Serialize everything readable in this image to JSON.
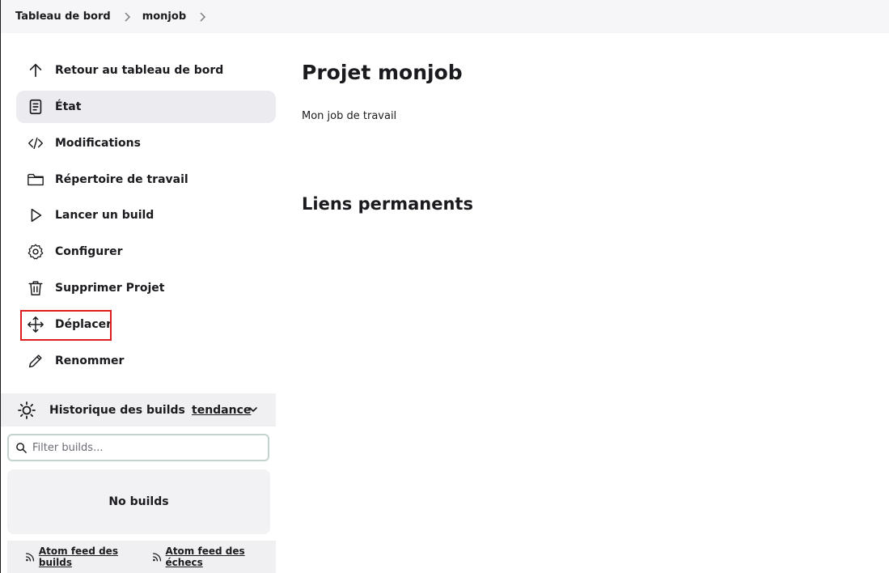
{
  "breadcrumb": {
    "items": [
      {
        "label": "Tableau de bord"
      },
      {
        "label": "monjob"
      }
    ]
  },
  "sidebar": {
    "tasks": [
      {
        "label": "Retour au tableau de bord",
        "icon": "arrow-up-icon"
      },
      {
        "label": "État",
        "icon": "document-icon",
        "active": true
      },
      {
        "label": "Modifications",
        "icon": "code-icon"
      },
      {
        "label": "Répertoire de travail",
        "icon": "folder-icon"
      },
      {
        "label": "Lancer un build",
        "icon": "play-icon"
      },
      {
        "label": "Configurer",
        "icon": "gear-icon"
      },
      {
        "label": "Supprimer Projet",
        "icon": "trash-icon"
      },
      {
        "label": "Déplacer",
        "icon": "move-icon",
        "highlighted": true
      },
      {
        "label": "Renommer",
        "icon": "pencil-icon"
      }
    ]
  },
  "build_history": {
    "title": "Historique des builds",
    "trend_label": "tendance",
    "filter_placeholder": "Filter builds...",
    "empty_text": "No builds",
    "feeds": {
      "all": "Atom feed des builds",
      "failures": "Atom feed des échecs"
    }
  },
  "main": {
    "title": "Projet monjob",
    "description": "Mon job de travail",
    "permalinks_title": "Liens permanents"
  },
  "colors": {
    "highlight": "#dd1e1e",
    "active_bg": "#ececf0",
    "topbar_bg": "#f6f6f8"
  }
}
